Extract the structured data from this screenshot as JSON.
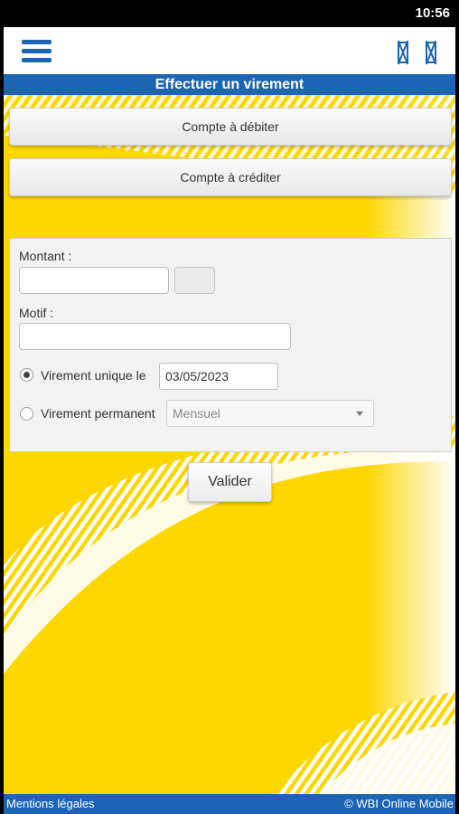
{
  "status_bar": {
    "time": "10:56"
  },
  "header": {
    "title": "Effectuer un virement"
  },
  "form": {
    "debit_account_label": "Compte à débiter",
    "credit_account_label": "Compte à créditer",
    "amount_label": "Montant  :",
    "amount_value": "",
    "currency_value": "",
    "reason_label": "Motif :",
    "reason_value": "",
    "single_transfer_label": "Virement unique le",
    "single_transfer_selected": true,
    "single_transfer_date": "03/05/2023",
    "permanent_transfer_label": "Virement permanent",
    "permanent_transfer_selected": false,
    "frequency_selected": "Mensuel",
    "submit_label": "Valider"
  },
  "footer": {
    "legal_link": "Mentions légales",
    "copyright": "© WBI Online Mobile"
  },
  "colors": {
    "brand_blue": "#1c64b4",
    "brand_yellow": "#fed600"
  },
  "icons": [
    "menu-icon",
    "placeholder-icon",
    "placeholder-icon"
  ]
}
